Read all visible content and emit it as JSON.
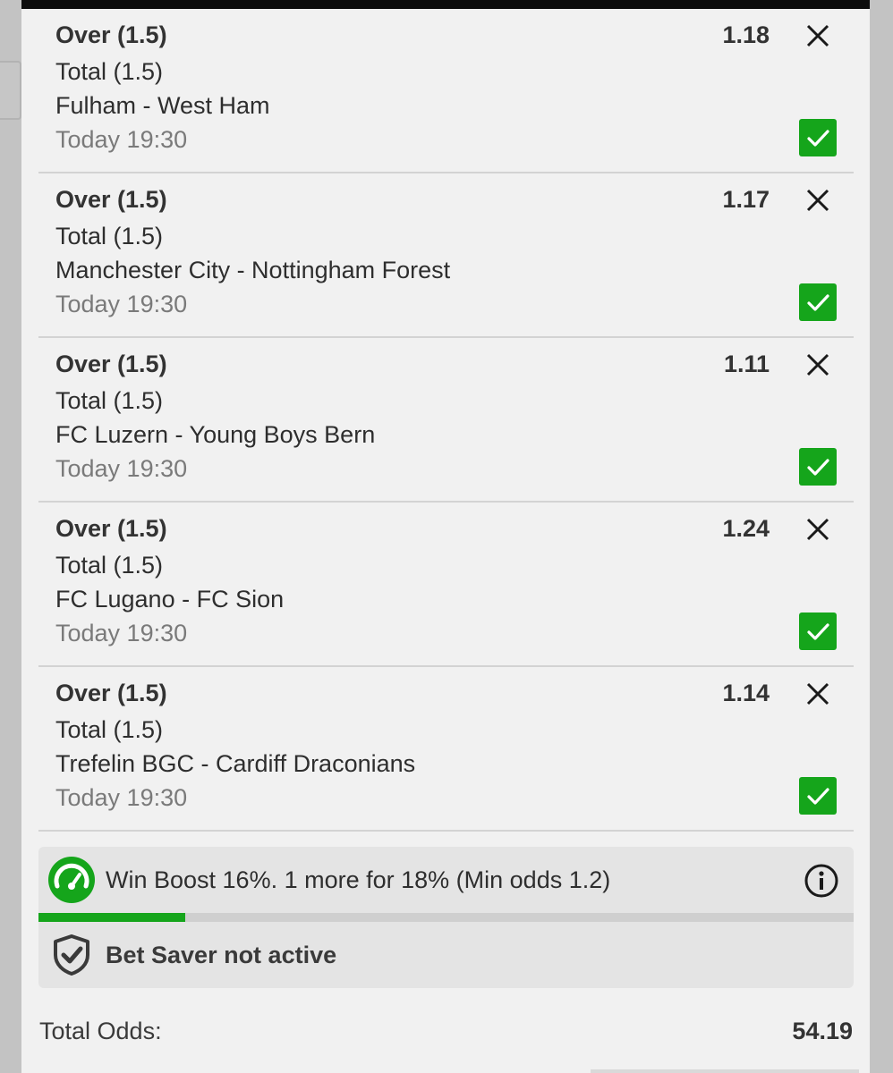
{
  "bet_slip": {
    "legs": [
      {
        "selection": "Over (1.5)",
        "odds": "1.18",
        "market": "Total (1.5)",
        "match": "Fulham - West Ham",
        "time": "Today 19:30",
        "included": true
      },
      {
        "selection": "Over (1.5)",
        "odds": "1.17",
        "market": "Total (1.5)",
        "match": "Manchester City - Nottingham Forest",
        "time": "Today 19:30",
        "included": true
      },
      {
        "selection": "Over (1.5)",
        "odds": "1.11",
        "market": "Total (1.5)",
        "match": "FC Luzern - Young Boys Bern",
        "time": "Today 19:30",
        "included": true
      },
      {
        "selection": "Over (1.5)",
        "odds": "1.24",
        "market": "Total (1.5)",
        "match": "FC Lugano - FC Sion",
        "time": "Today 19:30",
        "included": true
      },
      {
        "selection": "Over (1.5)",
        "odds": "1.14",
        "market": "Total (1.5)",
        "match": "Trefelin BGC - Cardiff Draconians",
        "time": "Today 19:30",
        "included": true
      }
    ],
    "win_boost": {
      "text": "Win Boost 16%. 1 more for 18% (Min odds 1.2)",
      "progress": 0.18,
      "icon": "speedometer-icon"
    },
    "bet_saver": {
      "text": "Bet Saver not active",
      "icon": "shield-check-icon"
    },
    "total": {
      "label": "Total Odds:",
      "value": "54.19"
    }
  },
  "colors": {
    "accent_green": "#15a51b",
    "sheet_background": "#f1f1f1",
    "panel_background": "#e4e4e4"
  }
}
